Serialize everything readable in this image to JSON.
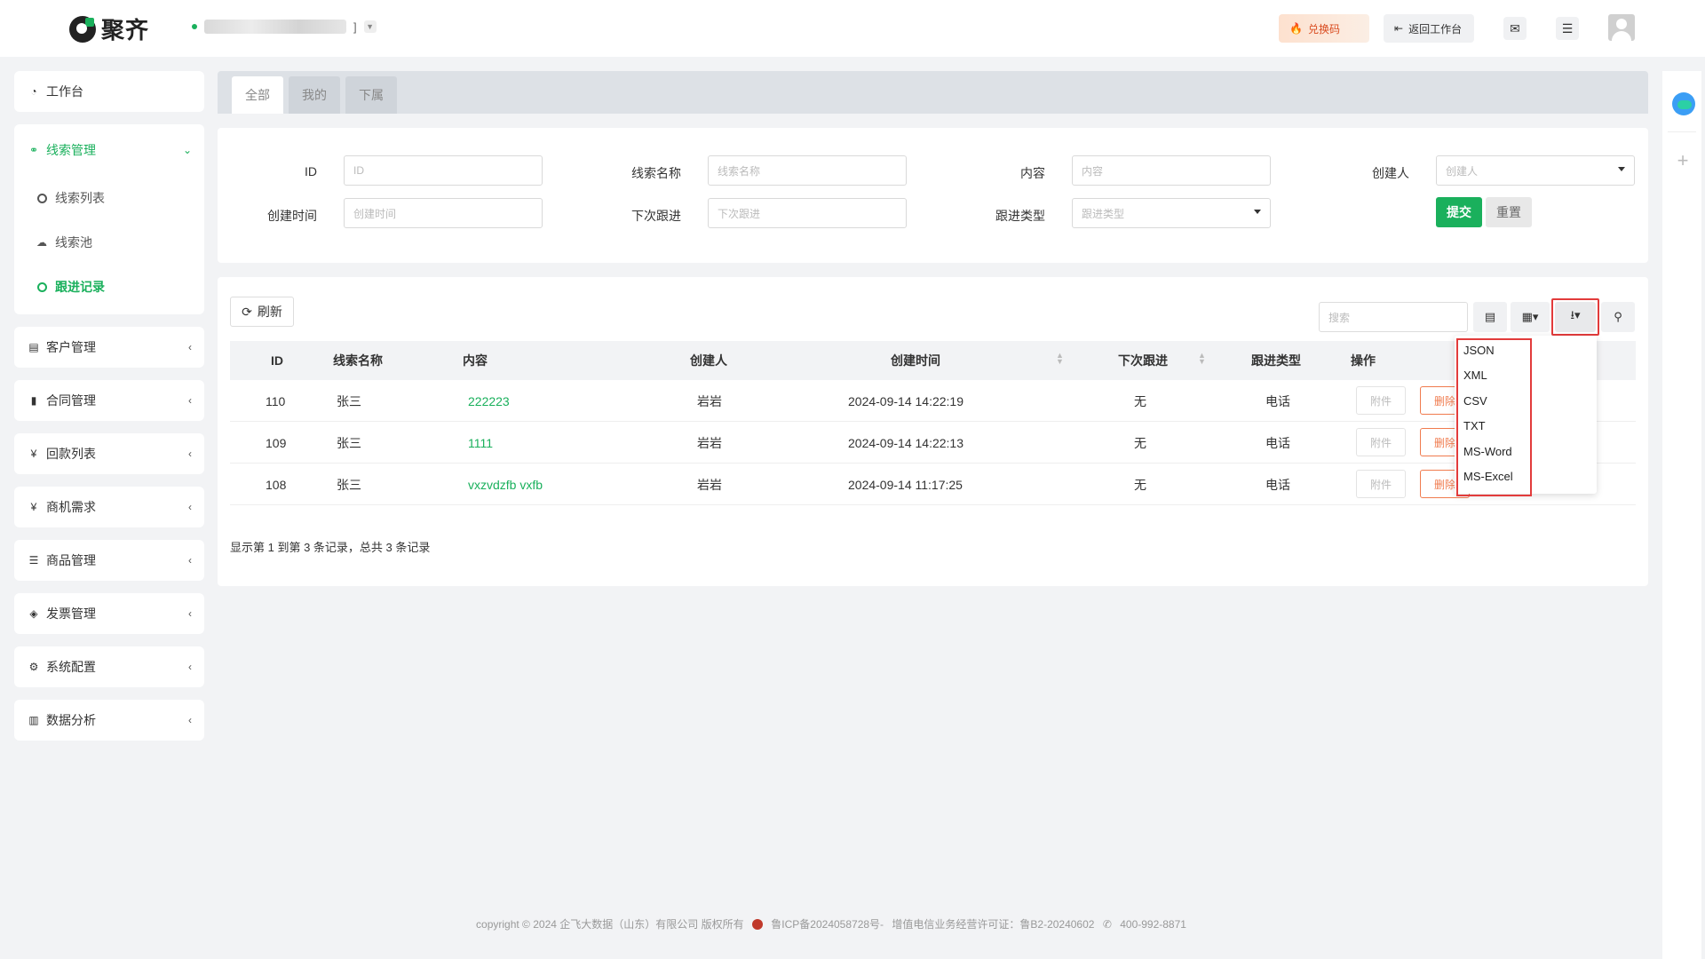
{
  "header": {
    "logo_text": "聚齐",
    "org_suffix": "]",
    "redeem_label": "兑换码",
    "back_label": "返回工作台"
  },
  "sidebar": {
    "workbench": "工作台",
    "leads": {
      "label": "线索管理",
      "sub": [
        "线索列表",
        "线索池",
        "跟进记录"
      ]
    },
    "groups": [
      "客户管理",
      "合同管理",
      "回款列表",
      "商机需求",
      "商品管理",
      "发票管理",
      "系统配置",
      "数据分析"
    ]
  },
  "tabs": [
    "全部",
    "我的",
    "下属"
  ],
  "filters": {
    "id_label": "ID",
    "id_placeholder": "ID",
    "name_label": "线索名称",
    "name_placeholder": "线索名称",
    "content_label": "内容",
    "content_placeholder": "内容",
    "creator_label": "创建人",
    "creator_placeholder": "创建人",
    "created_label": "创建时间",
    "created_placeholder": "创建时间",
    "next_label": "下次跟进",
    "next_placeholder": "下次跟进",
    "type_label": "跟进类型",
    "type_placeholder": "跟进类型",
    "submit": "提交",
    "reset": "重置"
  },
  "toolbar": {
    "refresh": "刷新",
    "search_placeholder": "搜索"
  },
  "table": {
    "columns": [
      "ID",
      "线索名称",
      "内容",
      "创建人",
      "创建时间",
      "下次跟进",
      "跟进类型",
      "操作"
    ],
    "rows": [
      {
        "id": "110",
        "name": "张三",
        "content": "222223",
        "creator": "岩岩",
        "created": "2024-09-14 14:22:19",
        "next": "无",
        "type": "电话",
        "attach": "附件",
        "delete": "删除"
      },
      {
        "id": "109",
        "name": "张三",
        "content": "1111",
        "creator": "岩岩",
        "created": "2024-09-14 14:22:13",
        "next": "无",
        "type": "电话",
        "attach": "附件",
        "delete": "删除"
      },
      {
        "id": "108",
        "name": "张三",
        "content": "vxzvdzfb vxfb",
        "creator": "岩岩",
        "created": "2024-09-14 11:17:25",
        "next": "无",
        "type": "电话",
        "attach": "附件",
        "delete": "删除"
      }
    ],
    "summary": "显示第 1 到第 3 条记录，总共 3 条记录"
  },
  "export_menu": [
    "JSON",
    "XML",
    "CSV",
    "TXT",
    "MS-Word",
    "MS-Excel"
  ],
  "footer": {
    "copyright": "copyright © 2024 企飞大数据（山东）有限公司 版权所有",
    "icp": "鲁ICP备2024058728号-",
    "license": "增值电信业务经营许可证：鲁B2-20240602",
    "phone": "400-992-8871"
  },
  "colors": {
    "accent": "#1ab05c",
    "danger": "#f07b4e",
    "highlight": "#e23b3b"
  }
}
